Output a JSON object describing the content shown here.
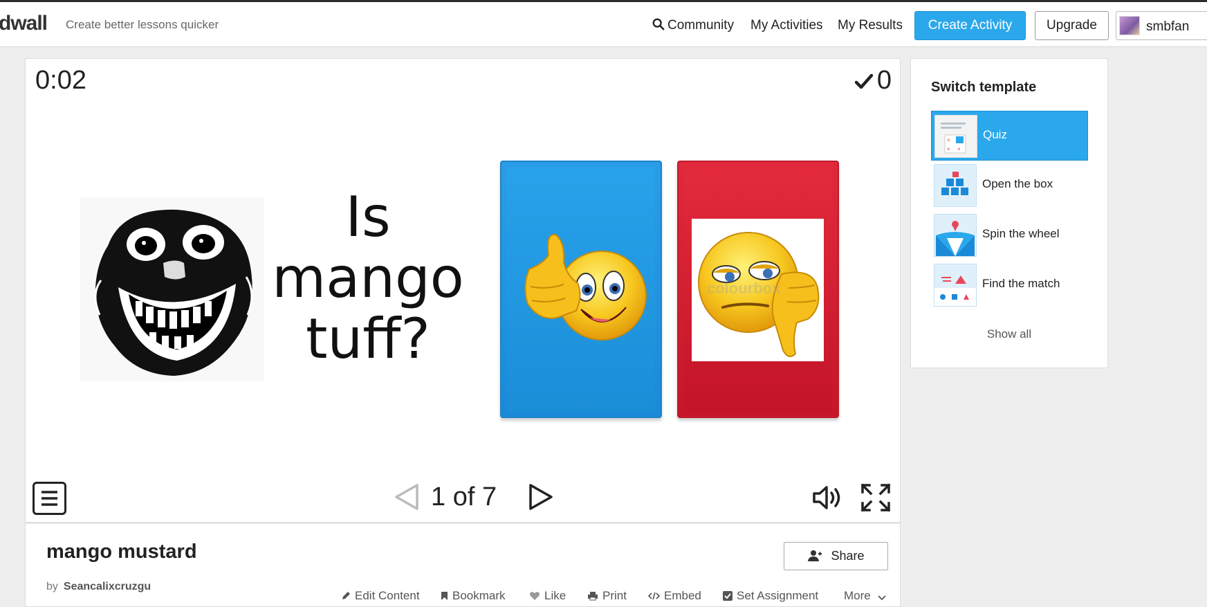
{
  "header": {
    "logo": "dwall",
    "tagline": "Create better lessons quicker",
    "nav": {
      "community": "Community",
      "my_activities": "My Activities",
      "my_results": "My Results"
    },
    "create_activity": "Create Activity",
    "upgrade": "Upgrade",
    "user_name": "smbfan"
  },
  "game": {
    "timer": "0:02",
    "score": "0",
    "question_text": "Is mango tuff?",
    "answers": [
      {
        "name": "thumbs-up",
        "color": "#1e90de"
      },
      {
        "name": "thumbs-down",
        "color": "#d11f31"
      }
    ],
    "watermark": "colourbox",
    "page_label": "1 of 7"
  },
  "info": {
    "title": "mango mustard",
    "by": "by",
    "author": "Seancalixcruzgu",
    "share": "Share",
    "actions": {
      "edit": "Edit Content",
      "bookmark": "Bookmark",
      "like": "Like",
      "print": "Print",
      "embed": "Embed",
      "assignment": "Set Assignment",
      "more": "More"
    }
  },
  "sidebar": {
    "title": "Switch template",
    "templates": [
      {
        "label": "Quiz",
        "active": true
      },
      {
        "label": "Open the box",
        "active": false
      },
      {
        "label": "Spin the wheel",
        "active": false
      },
      {
        "label": "Find the match",
        "active": false
      }
    ],
    "show_all": "Show all"
  },
  "colors": {
    "accent": "#2ba8ec",
    "blue_answer": "#1e90de",
    "red_answer": "#d11f31"
  }
}
